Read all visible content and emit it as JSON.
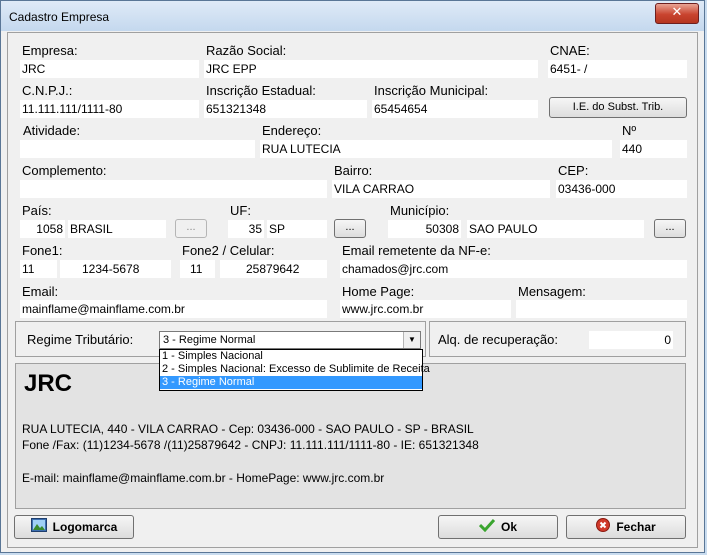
{
  "window": {
    "title": "Cadastro Empresa",
    "close_glyph": "✕"
  },
  "form": {
    "empresa": {
      "label": "Empresa:",
      "value": "JRC"
    },
    "razao_social": {
      "label": "Razão Social:",
      "value": "JRC EPP"
    },
    "cnae": {
      "label": "CNAE:",
      "value": "6451- /"
    },
    "cnpj": {
      "label": "C.N.P.J.:",
      "value": "11.111.111/1111-80"
    },
    "inscricao_estadual": {
      "label": "Inscrição Estadual:",
      "value": "651321348"
    },
    "inscricao_municipal": {
      "label": "Inscrição Municipal:",
      "value": "65454654"
    },
    "ie_subst_button": "I.E. do Subst. Trib.",
    "atividade": {
      "label": "Atividade:",
      "value": ""
    },
    "endereco": {
      "label": "Endereço:",
      "value": "RUA LUTECIA"
    },
    "numero": {
      "label": "Nº",
      "value": "440"
    },
    "complemento": {
      "label": "Complemento:",
      "value": ""
    },
    "bairro": {
      "label": "Bairro:",
      "value": "VILA CARRAO"
    },
    "cep": {
      "label": "CEP:",
      "value": "03436-000"
    },
    "pais": {
      "label": "País:",
      "code": "1058",
      "name": "BRASIL"
    },
    "uf": {
      "label": "UF:",
      "code": "35",
      "name": "SP"
    },
    "municipio": {
      "label": "Município:",
      "code": "50308",
      "name": "SAO PAULO"
    },
    "lookup_button": "...",
    "fone1": {
      "label": "Fone1:",
      "ddd": "11",
      "number": "1234-5678"
    },
    "fone2": {
      "label": "Fone2 / Celular:",
      "ddd": "11",
      "number": "25879642"
    },
    "email_nfe": {
      "label": "Email remetente da NF-e:",
      "value": "chamados@jrc.com"
    },
    "email": {
      "label": "Email:",
      "value": "mainflame@mainflame.com.br"
    },
    "home_page": {
      "label": "Home Page:",
      "value": "www.jrc.com.br"
    },
    "mensagem": {
      "label": "Mensagem:",
      "value": ""
    }
  },
  "regime": {
    "label": "Regime Tributário:",
    "selected": "3 - Regime Normal",
    "options": [
      "1 - Simples Nacional",
      "2 - Simples Nacional: Excesso de Sublimite de Receita",
      "3 - Regime Normal"
    ],
    "selected_index": 2
  },
  "aliquota": {
    "label": "Alq. de recuperação:",
    "value": "0"
  },
  "preview": {
    "name": "JRC",
    "line1": "RUA LUTECIA, 440 - VILA CARRAO - Cep: 03436-000 - SAO PAULO - SP - BRASIL",
    "line2": "Fone /Fax: (11)1234-5678 /(11)25879642 - CNPJ: 11.111.111/1111-80 - IE: 651321348",
    "line3": "E-mail: mainflame@mainflame.com.br - HomePage: www.jrc.com.br"
  },
  "buttons": {
    "logomarca": "Logomarca",
    "ok": "Ok",
    "fechar": "Fechar"
  },
  "icons": {
    "logomarca": "picture-icon",
    "ok": "check-icon",
    "fechar": "close-circle-icon"
  },
  "colors": {
    "selection": "#3399ff",
    "ok_green": "#3aa52f",
    "close_red": "#d0392a"
  }
}
